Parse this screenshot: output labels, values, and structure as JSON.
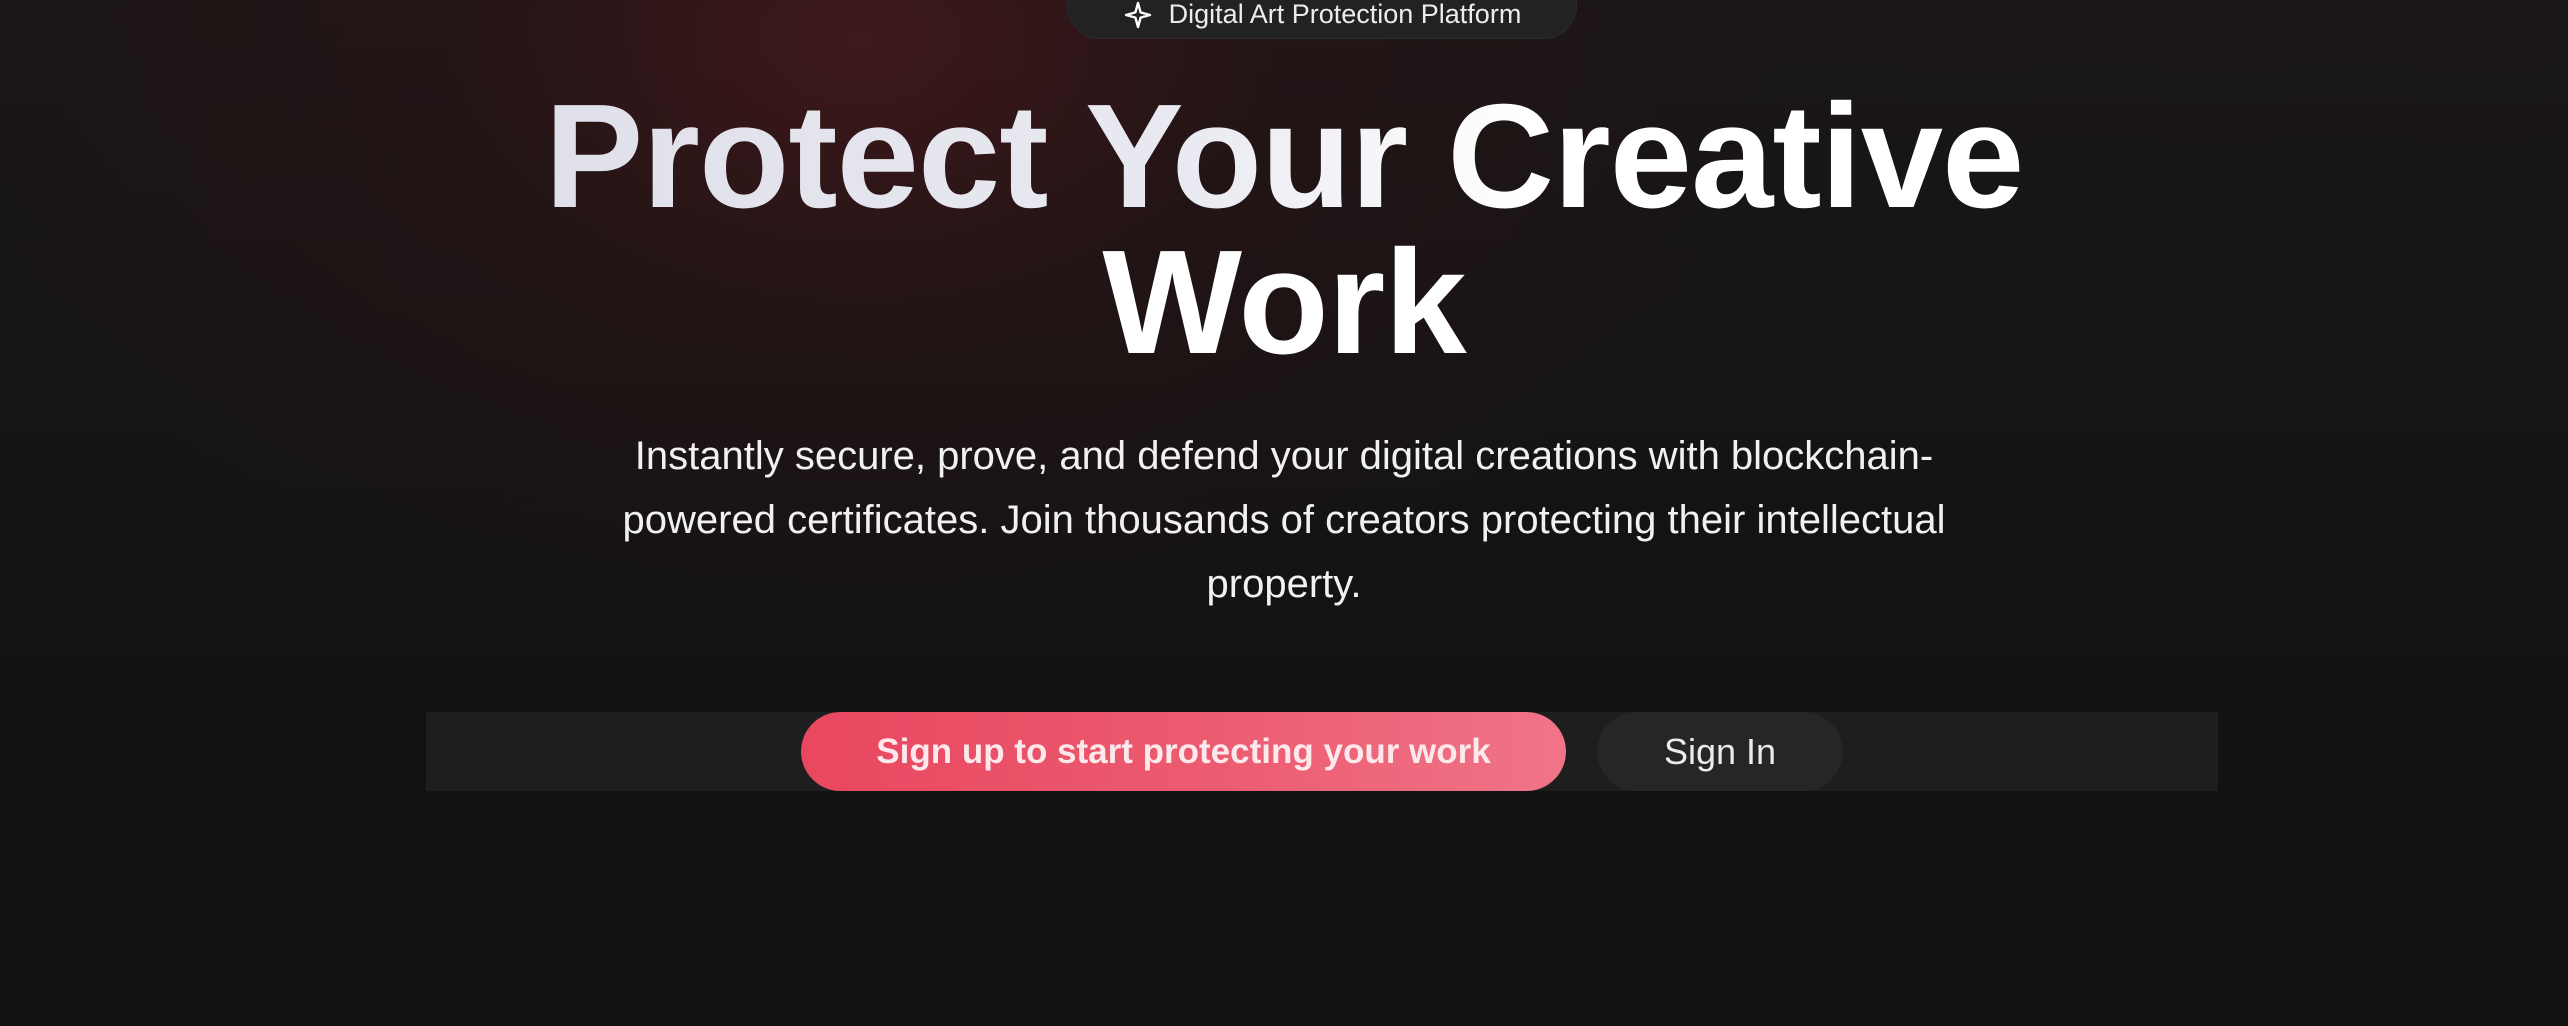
{
  "badge": {
    "icon": "sparkle-icon",
    "text": "Digital Art Protection Platform"
  },
  "hero": {
    "title_line1": "Protect Your Creative",
    "title_line2": "Work",
    "subtitle": "Instantly secure, prove, and defend your digital creations with blockchain-powered certificates. Join thousands of creators protecting their intellectual property."
  },
  "actions": {
    "primary_label": "Sign up to start protecting your work",
    "secondary_label": "Sign In"
  },
  "colors": {
    "background": "#121212",
    "accent_gradient_start": "#e8475f",
    "accent_gradient_end": "#f07488",
    "secondary_button": "#262626"
  }
}
